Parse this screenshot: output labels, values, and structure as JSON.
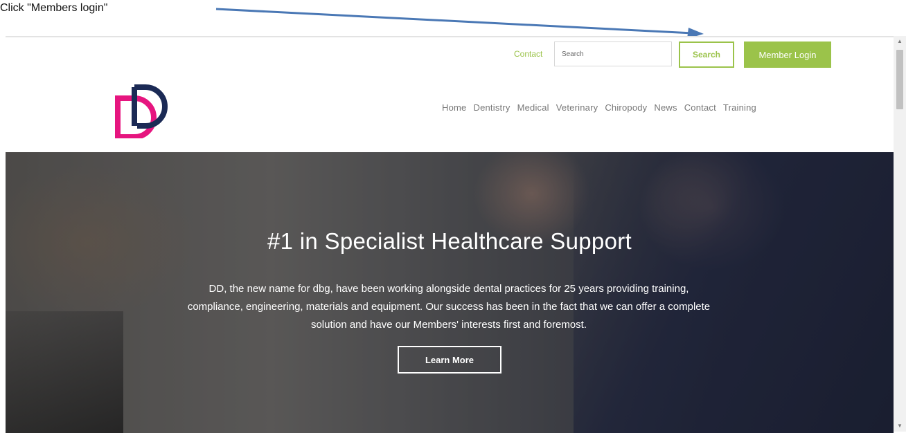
{
  "instruction": "Click \"Members login\"",
  "header": {
    "contact_link": "Contact",
    "search_placeholder": "Search",
    "search_button": "Search",
    "member_login": "Member Login",
    "logo_text": "DD"
  },
  "nav": {
    "items": [
      "Home",
      "Dentistry",
      "Medical",
      "Veterinary",
      "Chiropody",
      "News",
      "Contact",
      "Training"
    ]
  },
  "hero": {
    "title": "#1 in Specialist Healthcare Support",
    "text": "DD, the new name for dbg, have been working alongside dental practices for 25 years providing training, compliance, engineering, materials and equipment. Our success has been in the fact that we can offer a complete solution and have our Members' interests first and foremost.",
    "button": "Learn More"
  },
  "colors": {
    "accent_green": "#9bc34a",
    "logo_pink": "#e6157f",
    "logo_navy": "#1b2a55",
    "annotation_arrow": "#4a78b5"
  },
  "icons": {
    "scroll_up": "triangle-up",
    "scroll_down": "triangle-down"
  }
}
